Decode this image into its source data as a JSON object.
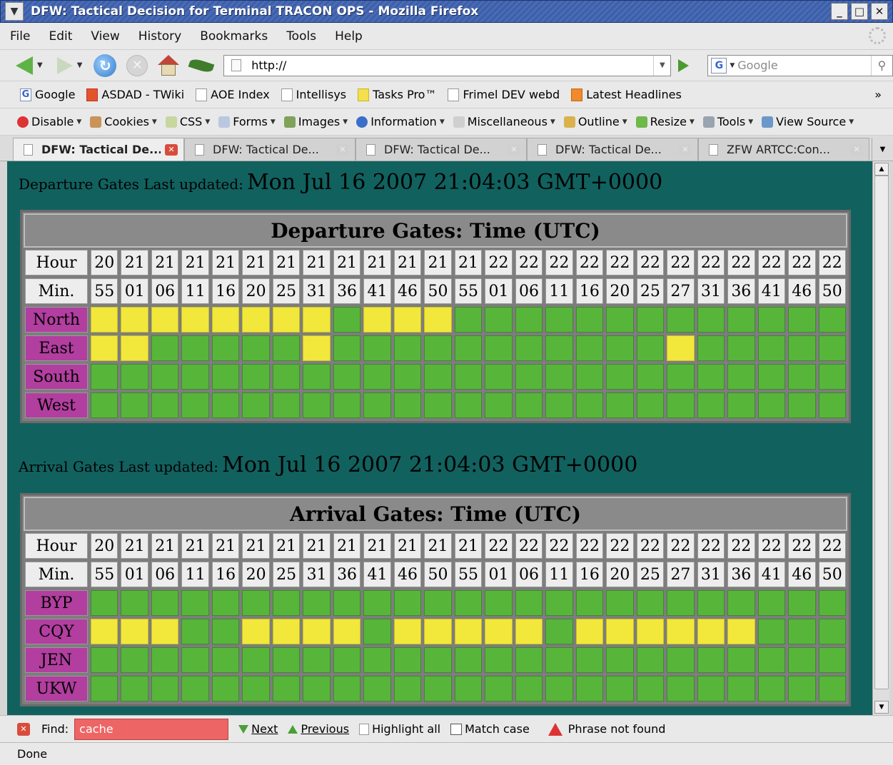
{
  "window": {
    "title": "DFW: Tactical Decision for Terminal TRACON OPS - Mozilla Firefox"
  },
  "menu": [
    "File",
    "Edit",
    "View",
    "History",
    "Bookmarks",
    "Tools",
    "Help"
  ],
  "nav": {
    "url": "http://",
    "search_placeholder": "Google"
  },
  "bookmarks": [
    "Google",
    "ASDAD - TWiki",
    "AOE Index",
    "Intellisys",
    "Tasks Pro™",
    "Frimel DEV webd",
    "Latest Headlines"
  ],
  "bookmarks_overflow": "»",
  "devbar": [
    "Disable",
    "Cookies",
    "CSS",
    "Forms",
    "Images",
    "Information",
    "Miscellaneous",
    "Outline",
    "Resize",
    "Tools",
    "View Source"
  ],
  "tabs": [
    "DFW: Tactical De...",
    "DFW: Tactical De...",
    "DFW: Tactical De...",
    "DFW: Tactical De...",
    "ZFW ARTCC:Con..."
  ],
  "departure": {
    "updated_label": "Departure Gates Last updated:",
    "updated_time": "Mon Jul 16 2007 21:04:03 GMT+0000",
    "title": "Departure Gates: Time (UTC)",
    "hour_label": "Hour",
    "min_label": "Min.",
    "hours": [
      "20",
      "21",
      "21",
      "21",
      "21",
      "21",
      "21",
      "21",
      "21",
      "21",
      "21",
      "21",
      "21",
      "22",
      "22",
      "22",
      "22",
      "22",
      "22",
      "22",
      "22",
      "22",
      "22",
      "22",
      "22"
    ],
    "minutes": [
      "55",
      "01",
      "06",
      "11",
      "16",
      "20",
      "25",
      "31",
      "36",
      "41",
      "46",
      "50",
      "55",
      "01",
      "06",
      "11",
      "16",
      "20",
      "25",
      "27",
      "31",
      "36",
      "41",
      "46",
      "50"
    ],
    "rows": [
      {
        "label": "North",
        "status": "YYYYYYYYGYYYGGGGGGGGGGGGG"
      },
      {
        "label": "East",
        "status": "YYGGGGGYGGGGGGGGGGGYGGGGG"
      },
      {
        "label": "South",
        "status": "GGGGGGGGGGGGGGGGGGGGGGGGG"
      },
      {
        "label": "West",
        "status": "GGGGGGGGGGGGGGGGGGGGGGGGG"
      }
    ]
  },
  "arrival": {
    "updated_label": "Arrival Gates Last updated:",
    "updated_time": "Mon Jul 16 2007 21:04:03 GMT+0000",
    "title": "Arrival Gates: Time (UTC)",
    "hour_label": "Hour",
    "min_label": "Min.",
    "hours": [
      "20",
      "21",
      "21",
      "21",
      "21",
      "21",
      "21",
      "21",
      "21",
      "21",
      "21",
      "21",
      "21",
      "22",
      "22",
      "22",
      "22",
      "22",
      "22",
      "22",
      "22",
      "22",
      "22",
      "22",
      "22"
    ],
    "minutes": [
      "55",
      "01",
      "06",
      "11",
      "16",
      "20",
      "25",
      "31",
      "36",
      "41",
      "46",
      "50",
      "55",
      "01",
      "06",
      "11",
      "16",
      "20",
      "25",
      "27",
      "31",
      "36",
      "41",
      "46",
      "50"
    ],
    "rows": [
      {
        "label": "BYP",
        "status": "GGGGGGGGGGGGGGGGGGGGGGGGG"
      },
      {
        "label": "CQY",
        "status": "YYYGGYYYYGYYYYYGYYYYYYGGG"
      },
      {
        "label": "JEN",
        "status": "GGGGGGGGGGGGGGGGGGGGGGGGG"
      },
      {
        "label": "UKW",
        "status": "GGGGGGGGGGGGGGGGGGGGGGGGG"
      }
    ]
  },
  "status_colors": {
    "G": "#57b63a",
    "Y": "#f1e83b"
  },
  "findbar": {
    "label": "Find:",
    "value": "cache",
    "next": "Next",
    "previous": "Previous",
    "highlight": "Highlight all",
    "match_case": "Match case",
    "message": "Phrase not found"
  },
  "statusbar": {
    "text": "Done"
  }
}
